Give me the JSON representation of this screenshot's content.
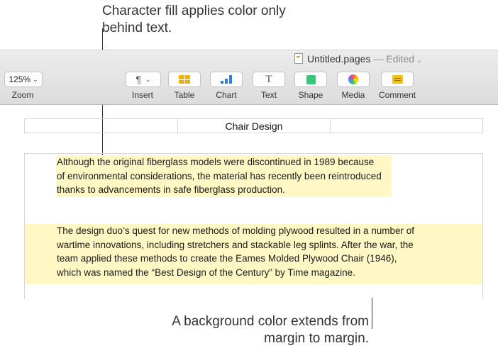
{
  "callouts": {
    "top": "Character fill applies color only behind text.",
    "bottom": "A background color extends from margin to margin."
  },
  "window": {
    "doc_name": "Untitled.pages",
    "separator": " — ",
    "status": "Edited"
  },
  "toolbar": {
    "zoom_value": "125%",
    "zoom_label": "Zoom",
    "insert_label": "Insert",
    "table_label": "Table",
    "chart_label": "Chart",
    "text_label": "Text",
    "shape_label": "Shape",
    "media_label": "Media",
    "comment_label": "Comment",
    "icons": [
      "pilcrow-icon",
      "table-icon",
      "chart-icon",
      "text-icon",
      "shape-icon",
      "media-icon",
      "comment-icon"
    ]
  },
  "document": {
    "header_cells": [
      "",
      "Chair Design",
      ""
    ],
    "paragraph1": "Although the original fiberglass models were discontinued in 1989 because of environmental considerations, the material has recently been reintroduced thanks to advancements in safe fiberglass production.",
    "paragraph2": "The design duo’s quest for new methods of molding plywood resulted in a number of wartime innovations, including stretchers and stackable leg splints. After the war, the team applied these methods to create the Eames Molded Plywood Chair (1946), which was named the “Best Design of the Century” by Time magazine.",
    "highlight_color": "#fff8c4"
  }
}
